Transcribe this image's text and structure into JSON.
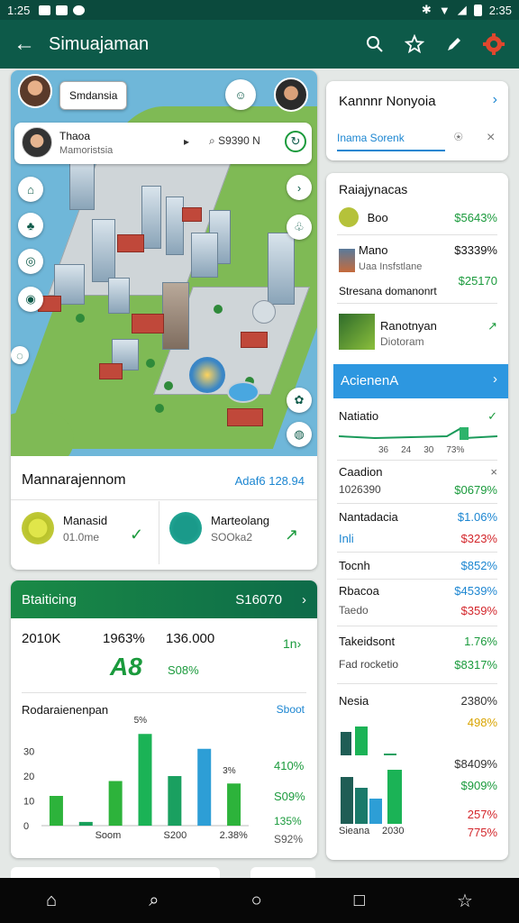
{
  "status": {
    "time_left": "1:25",
    "time_right": "2:35"
  },
  "appbar": {
    "title": "Simuajaman",
    "back_icon": "arrow-left-icon"
  },
  "map": {
    "top_chip": "Smdansia",
    "user_card": {
      "name": "Thaoa",
      "sub": "Mamoristsia",
      "value": "S9390 N"
    }
  },
  "summary": {
    "title": "Mannarajennom",
    "link": "Adaf6 128.94",
    "item1": {
      "title": "Manasid",
      "sub": "01.0me"
    },
    "item2": {
      "title": "Marteolang",
      "sub": "SOOka2"
    }
  },
  "stats": {
    "header_title": "Btaiticing",
    "header_value": "S16070",
    "num1": "2010K",
    "num2": "1963%",
    "num3": "136.000",
    "big": "A8",
    "big_sub": "S08%",
    "trend": "1n",
    "chart_title": "Rodaraienenpan",
    "chart_link": "Sboot",
    "side_values": [
      "410%",
      "S09%",
      "135%",
      "S92%"
    ]
  },
  "chart_data": {
    "type": "bar",
    "title": "Rodaraienenpan",
    "x_tick_labels": [
      "Soom",
      "S200",
      "2.38%"
    ],
    "y_tick_labels": [
      "0",
      "10",
      "20",
      "30"
    ],
    "annotations": [
      "5%",
      "3%"
    ],
    "ylim": [
      0,
      40
    ],
    "values": [
      12,
      1.5,
      18,
      37,
      20,
      31,
      17
    ],
    "colors": [
      "#2db33b",
      "#18a05a",
      "#2db33b",
      "#1bb356",
      "#1aa060",
      "#2d9ed6",
      "#2db33b"
    ]
  },
  "search": {
    "title": "Kannnr Nonyoia",
    "input": "Inama Sorenk"
  },
  "list": {
    "header": "Raiajynacas",
    "rows": [
      {
        "title": "Boo",
        "value": "$5643%"
      },
      {
        "title": "Mano",
        "sub": "Uaa Insfstlane",
        "value": "$3339%",
        "extra": "Stresana domanonrt",
        "extra_val": "$25170"
      },
      {
        "title": "Ranotnyan",
        "sub": "Diotoram"
      }
    ],
    "banner": "AcienenA",
    "mini": {
      "title": "Natiatio",
      "labels": [
        "36",
        "24",
        "30",
        "73%"
      ]
    },
    "metrics": [
      {
        "label": "Caadion",
        "sub": "1026390",
        "value": "$0679%"
      },
      {
        "label": "Nantadacia",
        "sub": "Inli",
        "value": "$1.06%",
        "value2": "$323%"
      },
      {
        "label": "Tocnh",
        "value": "$852%"
      },
      {
        "label": "Rbacoa",
        "sub": "Taedo",
        "value": "$4539%",
        "value2": "$359%"
      },
      {
        "label": "Takeidsont",
        "sub": "Fad rocketio",
        "value": "1.76%",
        "value2": "$8317%"
      }
    ],
    "nesia": {
      "title": "Nesia",
      "value": "2380%",
      "value_b": "498%",
      "values": [
        "$8409%",
        "$909%",
        "257%",
        "775%"
      ],
      "axis": [
        "Sieana",
        "2030"
      ]
    }
  }
}
